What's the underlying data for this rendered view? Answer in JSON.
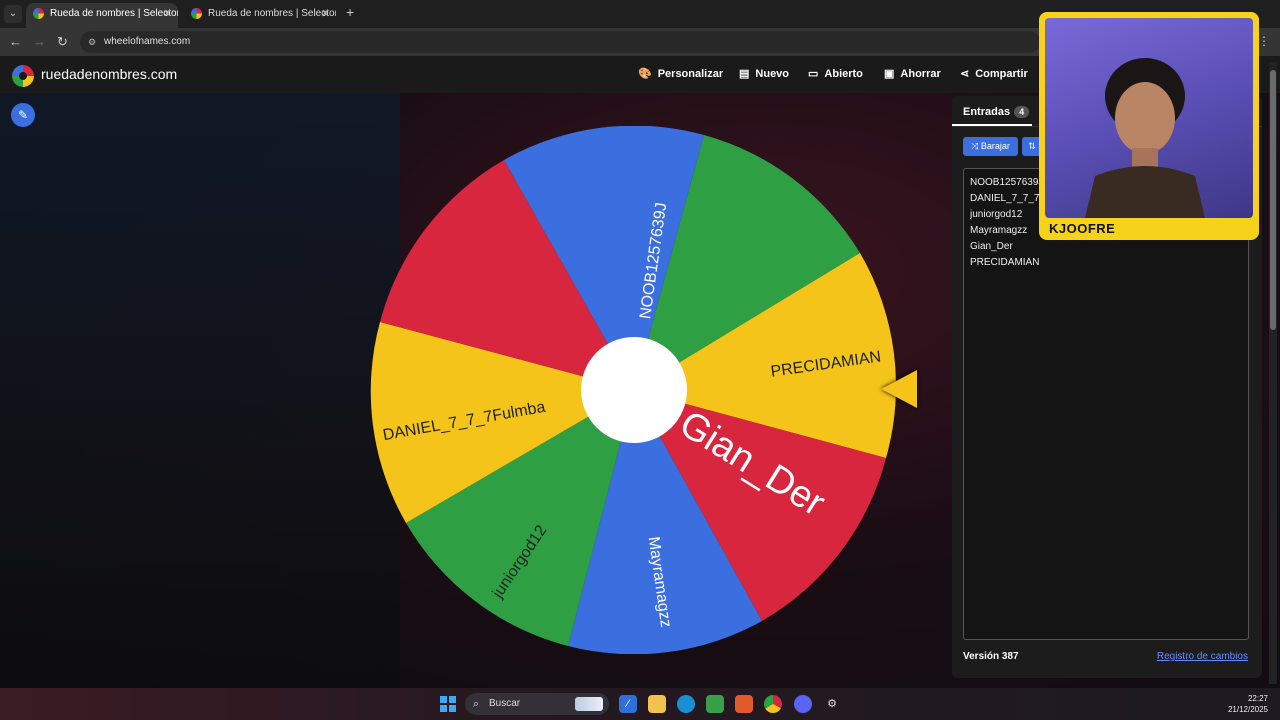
{
  "browser": {
    "tabs": [
      {
        "title": "Rueda de nombres | Selector de nombres aleatorios",
        "active": true
      },
      {
        "title": "Rueda de nombres | Selector de nombres aleatorios",
        "active": false
      }
    ],
    "url": "wheelofnames.com"
  },
  "site": {
    "brand": "ruedadenombres.com",
    "menu": [
      {
        "label": "Personalizar",
        "icon": "palette-icon"
      },
      {
        "label": "Nuevo",
        "icon": "file-icon"
      },
      {
        "label": "Abierto",
        "icon": "folder-icon"
      },
      {
        "label": "Ahorrar",
        "icon": "save-icon"
      },
      {
        "label": "Compartir",
        "icon": "share-icon"
      }
    ]
  },
  "wheel": {
    "colors": {
      "red": "#d7263d",
      "blue": "#3b6fe0",
      "green": "#2ea043",
      "yellow": "#f4c41a"
    },
    "labels": {
      "noob": "NOOB1257639J",
      "precidamian": "PRECIDAMIAN",
      "gian": "Gian_Der",
      "mayra": "Mayramagzz",
      "junior": "juniorgod12",
      "daniel": "DANIEL_7_7_7Fulmba"
    }
  },
  "panel": {
    "tab_label": "Entradas",
    "count": "4",
    "shuffle_label": "Barajar",
    "entries": [
      "NOOB1257639J",
      "DANIEL_7_7_7Fulmba",
      "juniorgod12",
      "Mayramagzz",
      "Gian_Der",
      "PRECIDAMIAN"
    ],
    "version": "Versión 387",
    "changelog": "Registro de cambios"
  },
  "webcam": {
    "label": "KJOOFRE"
  },
  "taskbar": {
    "search_placeholder": "Buscar",
    "time": "22:27",
    "date": "21/12/2025"
  }
}
